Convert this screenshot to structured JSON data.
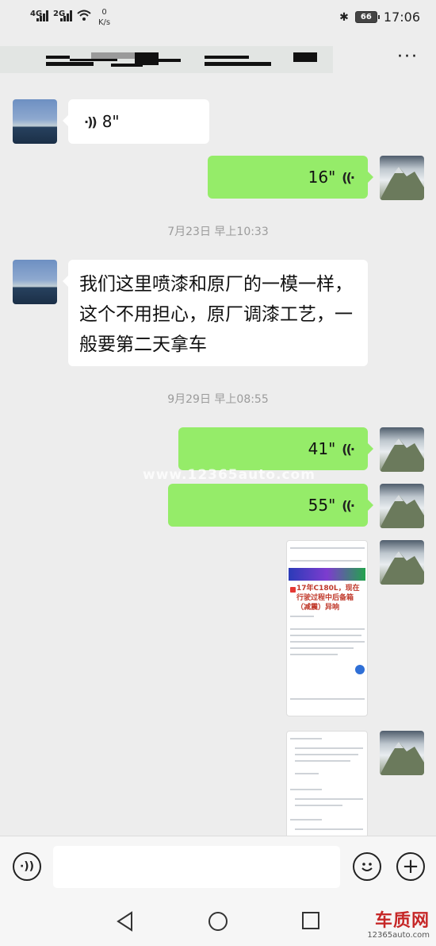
{
  "status_bar": {
    "network_1": "4G",
    "network_2": "2G",
    "speed_value": "0",
    "speed_unit": "K/s",
    "battery": "66",
    "time": "17:06"
  },
  "header": {
    "title": "",
    "more_label": "···"
  },
  "messages": {
    "voice_in_1": "8\"",
    "voice_out_1": "16\"",
    "time_1": "7月23日 早上10:33",
    "text_in_1": "我们这里喷漆和原厂的一模一样，这个不用担心，原厂调漆工艺，一般要第二天拿车",
    "time_2": "9月29日 早上08:55",
    "voice_out_2": "41\"",
    "voice_out_3": "55\""
  },
  "image_msg_1": {
    "title": "17年C180L，现在行驶过程中后备箱（减震）异响"
  },
  "watermark": "www.12365auto.com",
  "input_bar": {
    "voice_icon": "voice-toggle-icon",
    "emoji_icon": "emoji-icon",
    "plus_icon": "plus-icon"
  },
  "nav_bar": {
    "back_icon": "back-triangle-icon",
    "home_icon": "home-circle-icon",
    "recents_icon": "recents-square-icon"
  },
  "brand": {
    "name": "车质网",
    "url": "12365auto.com"
  },
  "colors": {
    "background": "#ededed",
    "outgoing_bubble": "#95ec69",
    "incoming_bubble": "#ffffff",
    "timestamp": "#9b9b9b"
  }
}
